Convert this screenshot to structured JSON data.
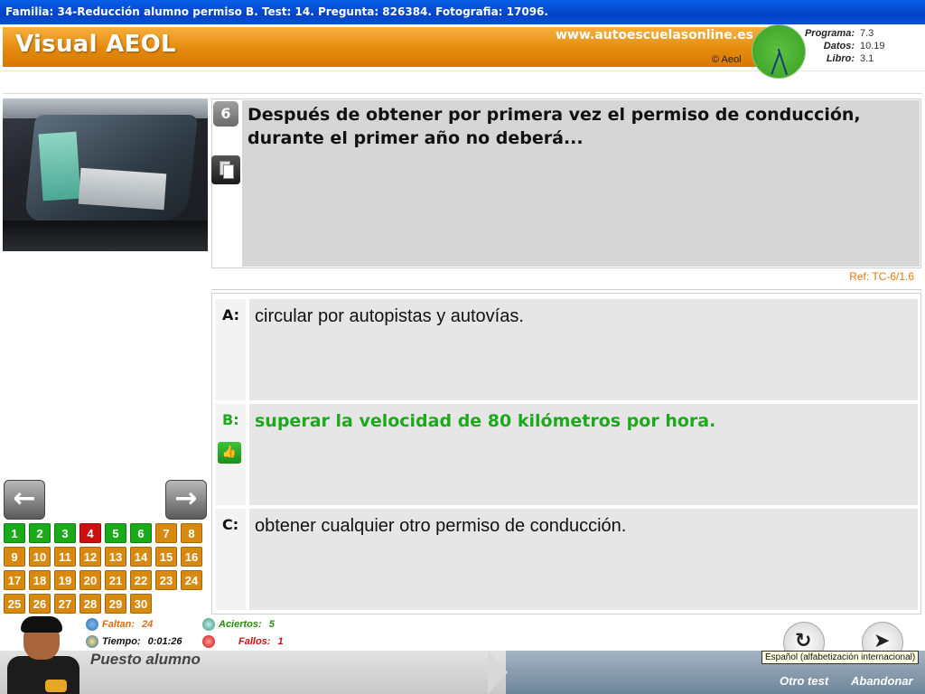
{
  "window": {
    "title": "Familia: 34-Reducción alumno permiso B. Test: 14. Pregunta: 826384. Fotografia: 17096."
  },
  "header": {
    "brand": "Visual AEOL",
    "site": "www.autoescuelasonline.es",
    "copyright": "© Aeol",
    "versions": [
      {
        "label": "Programa:",
        "value": "7.3"
      },
      {
        "label": "Datos:",
        "value": "10.19"
      },
      {
        "label": "Libro:",
        "value": "3.1"
      }
    ]
  },
  "question": {
    "number": "6",
    "text": "Después de obtener por primera vez el permiso de conducción, durante el primer año no deberá...",
    "ref": "Ref: TC-6/1.6"
  },
  "answers": [
    {
      "label": "A:",
      "text": "circular por autopistas y autovías.",
      "correct": false
    },
    {
      "label": "B:",
      "text": "superar la velocidad de 80 kilómetros por hora.",
      "correct": true
    },
    {
      "label": "C:",
      "text": "obtener cualquier otro permiso de conducción.",
      "correct": false
    }
  ],
  "nav": {
    "prev_icon": "arrow-left-icon",
    "next_icon": "arrow-right-icon",
    "questions": [
      {
        "n": "1",
        "status": "correct"
      },
      {
        "n": "2",
        "status": "correct"
      },
      {
        "n": "3",
        "status": "correct"
      },
      {
        "n": "4",
        "status": "wrong"
      },
      {
        "n": "5",
        "status": "correct"
      },
      {
        "n": "6",
        "status": "correct"
      },
      {
        "n": "7",
        "status": "pending"
      },
      {
        "n": "8",
        "status": "pending"
      },
      {
        "n": "9",
        "status": "pending"
      },
      {
        "n": "10",
        "status": "pending"
      },
      {
        "n": "11",
        "status": "pending"
      },
      {
        "n": "12",
        "status": "pending"
      },
      {
        "n": "13",
        "status": "pending"
      },
      {
        "n": "14",
        "status": "pending"
      },
      {
        "n": "15",
        "status": "pending"
      },
      {
        "n": "16",
        "status": "pending"
      },
      {
        "n": "17",
        "status": "pending"
      },
      {
        "n": "18",
        "status": "pending"
      },
      {
        "n": "19",
        "status": "pending"
      },
      {
        "n": "20",
        "status": "pending"
      },
      {
        "n": "21",
        "status": "pending"
      },
      {
        "n": "22",
        "status": "pending"
      },
      {
        "n": "23",
        "status": "pending"
      },
      {
        "n": "24",
        "status": "pending"
      },
      {
        "n": "25",
        "status": "pending"
      },
      {
        "n": "26",
        "status": "pending"
      },
      {
        "n": "27",
        "status": "pending"
      },
      {
        "n": "28",
        "status": "pending"
      },
      {
        "n": "29",
        "status": "pending"
      },
      {
        "n": "30",
        "status": "pending"
      }
    ]
  },
  "stats": {
    "faltan_label": "Faltan:",
    "faltan_value": "24",
    "tiempo_label": "Tiempo:",
    "tiempo_value": "0:01:26",
    "aciertos_label": "Aciertos:",
    "aciertos_value": "5",
    "fallos_label": "Fallos:",
    "fallos_value": "1"
  },
  "footer": {
    "station": "Puesto alumno",
    "tooltip": "Español (alfabetización internacional)",
    "otro_test": "Otro test",
    "abandonar": "Abandonar"
  },
  "colors": {
    "accent_orange": "#e58a0c",
    "correct_green": "#1aaa1a",
    "wrong_red": "#cc1010",
    "pending_orange": "#d88a10",
    "faltan_color": "#e06a10",
    "aciertos_color": "#2a8a10",
    "fallos_color": "#cc1010"
  }
}
